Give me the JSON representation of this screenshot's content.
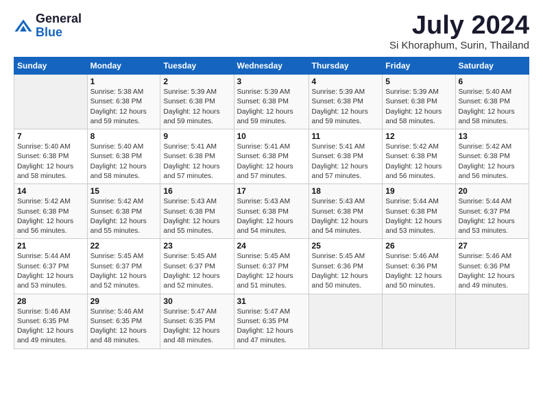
{
  "logo": {
    "general": "General",
    "blue": "Blue"
  },
  "title": "July 2024",
  "location": "Si Khoraphum, Surin, Thailand",
  "days_of_week": [
    "Sunday",
    "Monday",
    "Tuesday",
    "Wednesday",
    "Thursday",
    "Friday",
    "Saturday"
  ],
  "weeks": [
    [
      {
        "day": "",
        "info": ""
      },
      {
        "day": "1",
        "info": "Sunrise: 5:38 AM\nSunset: 6:38 PM\nDaylight: 12 hours\nand 59 minutes."
      },
      {
        "day": "2",
        "info": "Sunrise: 5:39 AM\nSunset: 6:38 PM\nDaylight: 12 hours\nand 59 minutes."
      },
      {
        "day": "3",
        "info": "Sunrise: 5:39 AM\nSunset: 6:38 PM\nDaylight: 12 hours\nand 59 minutes."
      },
      {
        "day": "4",
        "info": "Sunrise: 5:39 AM\nSunset: 6:38 PM\nDaylight: 12 hours\nand 59 minutes."
      },
      {
        "day": "5",
        "info": "Sunrise: 5:39 AM\nSunset: 6:38 PM\nDaylight: 12 hours\nand 58 minutes."
      },
      {
        "day": "6",
        "info": "Sunrise: 5:40 AM\nSunset: 6:38 PM\nDaylight: 12 hours\nand 58 minutes."
      }
    ],
    [
      {
        "day": "7",
        "info": "Sunrise: 5:40 AM\nSunset: 6:38 PM\nDaylight: 12 hours\nand 58 minutes."
      },
      {
        "day": "8",
        "info": "Sunrise: 5:40 AM\nSunset: 6:38 PM\nDaylight: 12 hours\nand 58 minutes."
      },
      {
        "day": "9",
        "info": "Sunrise: 5:41 AM\nSunset: 6:38 PM\nDaylight: 12 hours\nand 57 minutes."
      },
      {
        "day": "10",
        "info": "Sunrise: 5:41 AM\nSunset: 6:38 PM\nDaylight: 12 hours\nand 57 minutes."
      },
      {
        "day": "11",
        "info": "Sunrise: 5:41 AM\nSunset: 6:38 PM\nDaylight: 12 hours\nand 57 minutes."
      },
      {
        "day": "12",
        "info": "Sunrise: 5:42 AM\nSunset: 6:38 PM\nDaylight: 12 hours\nand 56 minutes."
      },
      {
        "day": "13",
        "info": "Sunrise: 5:42 AM\nSunset: 6:38 PM\nDaylight: 12 hours\nand 56 minutes."
      }
    ],
    [
      {
        "day": "14",
        "info": "Sunrise: 5:42 AM\nSunset: 6:38 PM\nDaylight: 12 hours\nand 56 minutes."
      },
      {
        "day": "15",
        "info": "Sunrise: 5:42 AM\nSunset: 6:38 PM\nDaylight: 12 hours\nand 55 minutes."
      },
      {
        "day": "16",
        "info": "Sunrise: 5:43 AM\nSunset: 6:38 PM\nDaylight: 12 hours\nand 55 minutes."
      },
      {
        "day": "17",
        "info": "Sunrise: 5:43 AM\nSunset: 6:38 PM\nDaylight: 12 hours\nand 54 minutes."
      },
      {
        "day": "18",
        "info": "Sunrise: 5:43 AM\nSunset: 6:38 PM\nDaylight: 12 hours\nand 54 minutes."
      },
      {
        "day": "19",
        "info": "Sunrise: 5:44 AM\nSunset: 6:38 PM\nDaylight: 12 hours\nand 53 minutes."
      },
      {
        "day": "20",
        "info": "Sunrise: 5:44 AM\nSunset: 6:37 PM\nDaylight: 12 hours\nand 53 minutes."
      }
    ],
    [
      {
        "day": "21",
        "info": "Sunrise: 5:44 AM\nSunset: 6:37 PM\nDaylight: 12 hours\nand 53 minutes."
      },
      {
        "day": "22",
        "info": "Sunrise: 5:45 AM\nSunset: 6:37 PM\nDaylight: 12 hours\nand 52 minutes."
      },
      {
        "day": "23",
        "info": "Sunrise: 5:45 AM\nSunset: 6:37 PM\nDaylight: 12 hours\nand 52 minutes."
      },
      {
        "day": "24",
        "info": "Sunrise: 5:45 AM\nSunset: 6:37 PM\nDaylight: 12 hours\nand 51 minutes."
      },
      {
        "day": "25",
        "info": "Sunrise: 5:45 AM\nSunset: 6:36 PM\nDaylight: 12 hours\nand 50 minutes."
      },
      {
        "day": "26",
        "info": "Sunrise: 5:46 AM\nSunset: 6:36 PM\nDaylight: 12 hours\nand 50 minutes."
      },
      {
        "day": "27",
        "info": "Sunrise: 5:46 AM\nSunset: 6:36 PM\nDaylight: 12 hours\nand 49 minutes."
      }
    ],
    [
      {
        "day": "28",
        "info": "Sunrise: 5:46 AM\nSunset: 6:35 PM\nDaylight: 12 hours\nand 49 minutes."
      },
      {
        "day": "29",
        "info": "Sunrise: 5:46 AM\nSunset: 6:35 PM\nDaylight: 12 hours\nand 48 minutes."
      },
      {
        "day": "30",
        "info": "Sunrise: 5:47 AM\nSunset: 6:35 PM\nDaylight: 12 hours\nand 48 minutes."
      },
      {
        "day": "31",
        "info": "Sunrise: 5:47 AM\nSunset: 6:35 PM\nDaylight: 12 hours\nand 47 minutes."
      },
      {
        "day": "",
        "info": ""
      },
      {
        "day": "",
        "info": ""
      },
      {
        "day": "",
        "info": ""
      }
    ]
  ]
}
